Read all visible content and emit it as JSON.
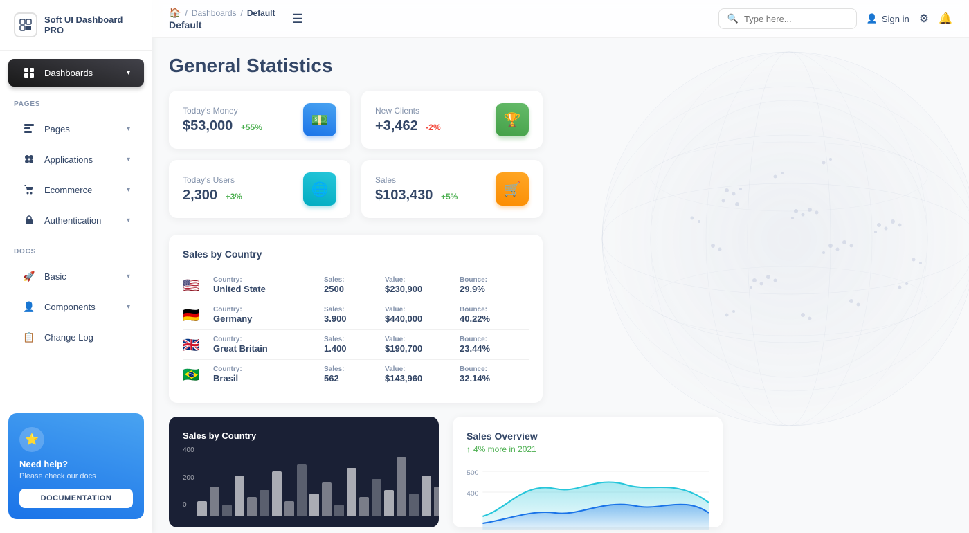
{
  "app": {
    "name": "Soft UI Dashboard PRO"
  },
  "sidebar": {
    "sections": [
      {
        "label": "PAGES",
        "items": [
          {
            "id": "dashboards",
            "label": "Dashboards",
            "icon": "⊞",
            "active": true,
            "hasChevron": true
          },
          {
            "id": "pages",
            "label": "Pages",
            "icon": "📊",
            "active": false,
            "hasChevron": true
          },
          {
            "id": "applications",
            "label": "Applications",
            "icon": "🔧",
            "active": false,
            "hasChevron": true
          },
          {
            "id": "ecommerce",
            "label": "Ecommerce",
            "icon": "🛒",
            "active": false,
            "hasChevron": true
          },
          {
            "id": "authentication",
            "label": "Authentication",
            "icon": "📄",
            "active": false,
            "hasChevron": true
          }
        ]
      },
      {
        "label": "DOCS",
        "items": [
          {
            "id": "basic",
            "label": "Basic",
            "icon": "🚀",
            "active": false,
            "hasChevron": true
          },
          {
            "id": "components",
            "label": "Components",
            "icon": "👤",
            "active": false,
            "hasChevron": true
          },
          {
            "id": "changelog",
            "label": "Change Log",
            "icon": "📋",
            "active": false,
            "hasChevron": false
          }
        ]
      }
    ],
    "help": {
      "title": "Need help?",
      "subtitle": "Please check our docs",
      "button_label": "DOCUMENTATION"
    }
  },
  "header": {
    "breadcrumb": {
      "home": "🏠",
      "separator1": "/",
      "link": "Dashboards",
      "separator2": "/",
      "current": "Default"
    },
    "page_title": "Default",
    "search_placeholder": "Type here...",
    "sign_in_label": "Sign in"
  },
  "page": {
    "title": "General Statistics"
  },
  "stats": [
    {
      "id": "money",
      "label": "Today's Money",
      "value": "$53,000",
      "change": "+55%",
      "change_type": "pos",
      "icon": "💵",
      "icon_style": "blue"
    },
    {
      "id": "clients",
      "label": "New Clients",
      "value": "+3,462",
      "change": "-2%",
      "change_type": "neg",
      "icon": "🏆",
      "icon_style": "green"
    },
    {
      "id": "users",
      "label": "Today's Users",
      "value": "2,300",
      "change": "+3%",
      "change_type": "pos",
      "icon": "🌐",
      "icon_style": "blue2"
    },
    {
      "id": "sales",
      "label": "Sales",
      "value": "$103,430",
      "change": "+5%",
      "change_type": "pos",
      "icon": "🛒",
      "icon_style": "orange"
    }
  ],
  "sales_by_country": {
    "title": "Sales by Country",
    "headers": {
      "country": "Country:",
      "sales": "Sales:",
      "value": "Value:",
      "bounce": "Bounce:"
    },
    "rows": [
      {
        "id": "us",
        "flag": "🇺🇸",
        "country": "United State",
        "sales": "2500",
        "value": "$230,900",
        "bounce": "29.9%"
      },
      {
        "id": "de",
        "flag": "🇩🇪",
        "country": "Germany",
        "sales": "3.900",
        "value": "$440,000",
        "bounce": "40.22%"
      },
      {
        "id": "gb",
        "flag": "🇬🇧",
        "country": "Great Britain",
        "sales": "1.400",
        "value": "$190,700",
        "bounce": "23.44%"
      },
      {
        "id": "br",
        "flag": "🇧🇷",
        "country": "Brasil",
        "sales": "562",
        "value": "$143,960",
        "bounce": "32.14%"
      }
    ]
  },
  "bar_chart": {
    "y_labels": [
      "400",
      "200",
      "0"
    ],
    "bars": [
      20,
      40,
      15,
      55,
      25,
      35,
      60,
      20,
      70,
      30,
      45,
      15,
      65,
      25,
      50,
      35,
      80,
      30,
      55,
      40
    ]
  },
  "sales_overview": {
    "title": "Sales Overview",
    "subtitle": "4% more in 2021",
    "y_labels": [
      "500",
      "400"
    ]
  }
}
